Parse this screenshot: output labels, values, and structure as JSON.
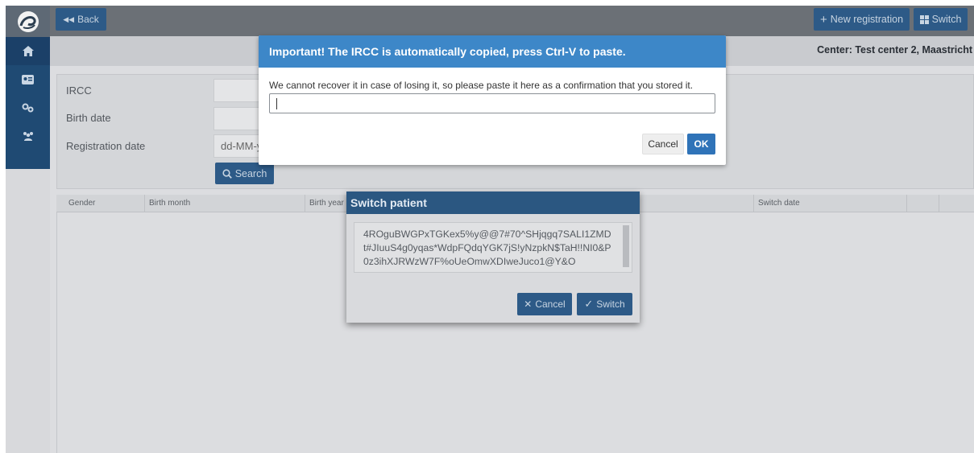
{
  "topbar": {
    "back_label": "Back",
    "new_registration_label": "New registration",
    "switch_label": "Switch",
    "center_text": "Center: Test center 2, Maastricht"
  },
  "sidebar": {
    "items": [
      {
        "icon": "home-icon"
      },
      {
        "icon": "id-card-icon"
      },
      {
        "icon": "gears-icon"
      },
      {
        "icon": "users-icon"
      }
    ]
  },
  "search": {
    "ircc_label": "IRCC",
    "birth_date_label": "Birth date",
    "registration_date_label": "Registration date",
    "registration_date_placeholder": "dd-MM-y",
    "search_label": "Search"
  },
  "table": {
    "columns": [
      "Gender",
      "Birth month",
      "Birth year",
      "Switch date"
    ]
  },
  "confirm_modal": {
    "title": "Important! The IRCC is automatically copied, press Ctrl-V to paste.",
    "message": "We cannot recover it in case of losing it, so please paste it here as a confirmation that you stored it.",
    "input_value": "",
    "cancel_label": "Cancel",
    "ok_label": "OK"
  },
  "switch_modal": {
    "title": "Switch patient",
    "code": "4ROguBWGPxTGKex5%y@@7#70^SHjqgq7SALI1ZMDt#JIuuS4g0yqas*WdpFQdqYGK7jS!yNzpkN$TaH!!NI0&P0z3ihXJRWzW7F%oUeOmwXDIweJuco1@Y&O",
    "cancel_label": "Cancel",
    "switch_label": "Switch"
  }
}
